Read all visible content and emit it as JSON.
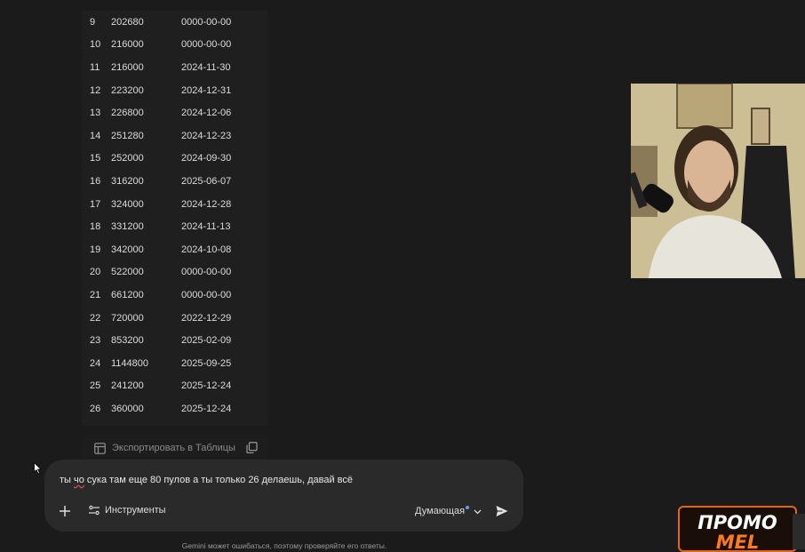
{
  "table": {
    "rows": [
      [
        "9",
        "202680",
        "0000-00-00"
      ],
      [
        "10",
        "216000",
        "0000-00-00"
      ],
      [
        "11",
        "216000",
        "2024-11-30"
      ],
      [
        "12",
        "223200",
        "2024-12-31"
      ],
      [
        "13",
        "226800",
        "2024-12-06"
      ],
      [
        "14",
        "251280",
        "2024-12-23"
      ],
      [
        "15",
        "252000",
        "2024-09-30"
      ],
      [
        "16",
        "316200",
        "2025-06-07"
      ],
      [
        "17",
        "324000",
        "2024-12-28"
      ],
      [
        "18",
        "331200",
        "2024-11-13"
      ],
      [
        "19",
        "342000",
        "2024-10-08"
      ],
      [
        "20",
        "522000",
        "0000-00-00"
      ],
      [
        "21",
        "661200",
        "0000-00-00"
      ],
      [
        "22",
        "720000",
        "2022-12-29"
      ],
      [
        "23",
        "853200",
        "2025-02-09"
      ],
      [
        "24",
        "1144800",
        "2025-09-25"
      ],
      [
        "25",
        "241200",
        "2025-12-24"
      ],
      [
        "26",
        "360000",
        "2025-12-24"
      ]
    ]
  },
  "export": {
    "label": "Экспортировать в Таблицы",
    "icon": "table-icon",
    "copy_icon": "copy-icon"
  },
  "prompt": {
    "text_before": "ты ",
    "text_typo": "чо",
    "text_after": " сука там еще 80 пулов а ты только 26 делаешь, давай всё"
  },
  "toolbar": {
    "tools_label": "Инструменты",
    "mode_label": "Думающая",
    "plus_icon": "plus-icon",
    "send_icon": "send-icon"
  },
  "disclaimer": "Gemini может ошибаться, поэтому проверяйте его ответы.",
  "overlay": {
    "promo_line1": "ПРОМО",
    "promo_line2": "MEL"
  },
  "colors": {
    "background": "#1b1b1b",
    "input_bg": "#2a2a2a",
    "accent_dot": "#5b9cf5",
    "promo_border": "#e8650c"
  }
}
